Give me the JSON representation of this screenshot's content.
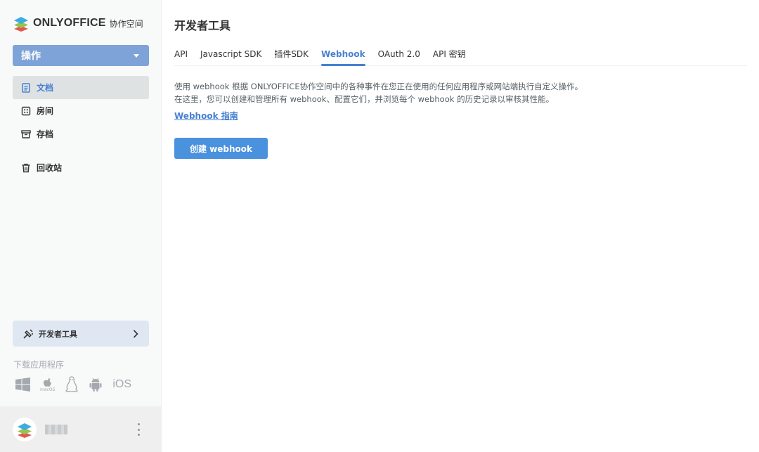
{
  "logo": {
    "name": "ONLYOFFICE",
    "sub": "协作空间"
  },
  "sidebar": {
    "actions_label": "操作",
    "items": [
      {
        "label": "文档",
        "icon": "document-icon",
        "active": true
      },
      {
        "label": "房间",
        "icon": "rooms-icon",
        "active": false
      },
      {
        "label": "存档",
        "icon": "archive-icon",
        "active": false
      },
      {
        "label": "回收站",
        "icon": "trash-icon",
        "active": false
      }
    ],
    "devtools_label": "开发者工具",
    "download_title": "下载应用程序",
    "apps": [
      "windows-icon",
      "macos-icon",
      "linux-icon",
      "android-icon",
      "ios-icon"
    ],
    "macos_label": "macOS",
    "ios_label": "iOS"
  },
  "profile": {
    "name": "████"
  },
  "main": {
    "title": "开发者工具",
    "tabs": [
      {
        "label": "API",
        "active": false
      },
      {
        "label": "Javascript SDK",
        "active": false
      },
      {
        "label": "插件SDK",
        "active": false
      },
      {
        "label": "Webhook",
        "active": true
      },
      {
        "label": "OAuth 2.0",
        "active": false
      },
      {
        "label": "API 密钥",
        "active": false
      }
    ],
    "desc_line1": "使用 webhook 根据 ONLYOFFICE协作空间中的各种事件在您正在使用的任何应用程序或网站端执行自定义操作。",
    "desc_line2": "在这里，您可以创建和管理所有 webhook、配置它们，并浏览每个 webhook 的历史记录以审核其性能。",
    "guide_link": "Webhook 指南",
    "create_button": "创建 webhook"
  },
  "colors": {
    "accent": "#4781d1",
    "button": "#4a91de",
    "actions_button": "#7ea3d8",
    "sidebar_bg": "#f8f9f9"
  }
}
